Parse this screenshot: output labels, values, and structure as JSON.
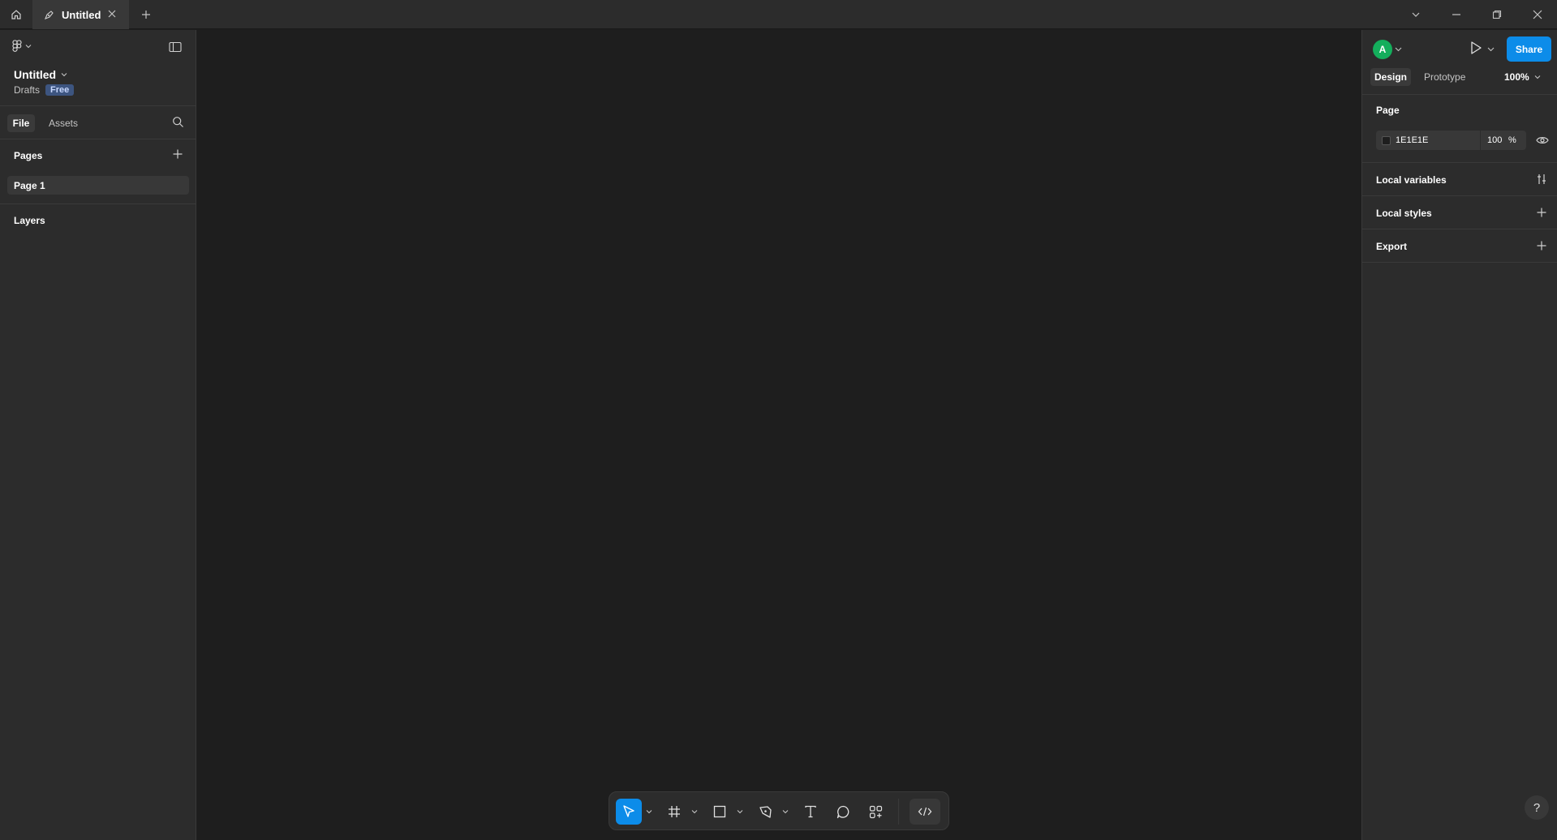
{
  "title_bar": {
    "tab_label": "Untitled"
  },
  "left_panel": {
    "file_name": "Untitled",
    "location": "Drafts",
    "plan_badge": "Free",
    "tabs": [
      "File",
      "Assets"
    ],
    "pages_heading": "Pages",
    "pages": [
      "Page 1"
    ],
    "layers_heading": "Layers"
  },
  "right_panel": {
    "avatar_initial": "A",
    "share_label": "Share",
    "tabs": [
      "Design",
      "Prototype"
    ],
    "zoom": "100%",
    "page_heading": "Page",
    "background": {
      "hex": "1E1E1E",
      "opacity": "100",
      "percent_sign": "%"
    },
    "sections": [
      "Local variables",
      "Local styles",
      "Export"
    ],
    "help_label": "?"
  },
  "colors": {
    "accent": "#0c8ce9",
    "avatar": "#14ae5c",
    "canvas": "#1e1e1e",
    "panel": "#2c2c2c"
  },
  "icons": {
    "toolbar": [
      "move-icon",
      "frame-icon",
      "rectangle-icon",
      "pen-icon",
      "text-icon",
      "comment-icon",
      "components-icon",
      "dev-mode-icon"
    ]
  }
}
